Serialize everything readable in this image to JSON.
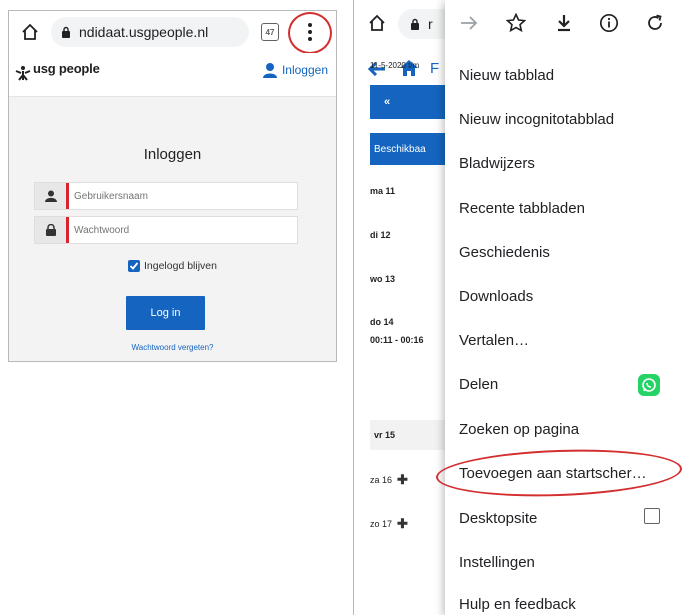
{
  "left": {
    "url": "ndidaat.usgpeople.nl",
    "tab_count": "47",
    "logo_text": "usg people",
    "header_login": "Inloggen",
    "login_title": "Inloggen",
    "username_placeholder": "Gebruikersnaam",
    "password_placeholder": "Wachtwoord",
    "keep_logged_in": "Ingelogd blijven",
    "login_button": "Log in",
    "forgot_password": "Wachtwoord vergeten?"
  },
  "right": {
    "url_fragment": "r",
    "page_letter": "F",
    "date_range": "11-5-2020 t/m",
    "prev_button": "«",
    "availability_button": "Beschikbaa",
    "days": [
      {
        "label": "ma 11"
      },
      {
        "label": "di 12"
      },
      {
        "label": "wo 13"
      },
      {
        "label": "do 14",
        "time": "00:11 - 00:16"
      },
      {
        "label": "vr 15"
      },
      {
        "label": "za 16"
      },
      {
        "label": "zo 17"
      }
    ]
  },
  "menu": {
    "items": [
      {
        "label": "Nieuw tabblad"
      },
      {
        "label": "Nieuw incognitotabblad"
      },
      {
        "label": "Bladwijzers"
      },
      {
        "label": "Recente tabbladen"
      },
      {
        "label": "Geschiedenis"
      },
      {
        "label": "Downloads"
      },
      {
        "label": "Vertalen…"
      },
      {
        "label": "Delen"
      },
      {
        "label": "Zoeken op pagina"
      },
      {
        "label": "Toevoegen aan startscher…"
      },
      {
        "label": "Desktopsite"
      },
      {
        "label": "Instellingen"
      },
      {
        "label": "Hulp en feedback"
      }
    ]
  },
  "colors": {
    "brand_blue": "#1565c0",
    "highlight_red": "#d32f2f",
    "whatsapp_green": "#25d366"
  }
}
